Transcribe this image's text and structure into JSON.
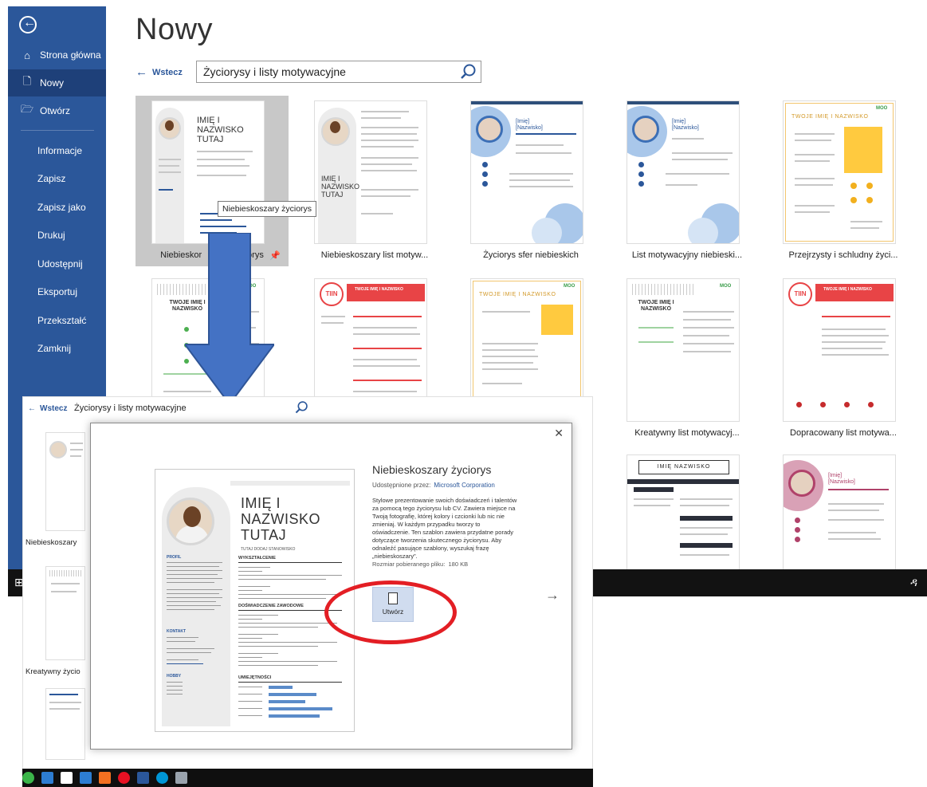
{
  "window": {
    "title": "Nowy",
    "sidebar": {
      "items": [
        {
          "label": "Strona główna",
          "icon": "home-icon"
        },
        {
          "label": "Nowy",
          "icon": "new-document-icon"
        },
        {
          "label": "Otwórz",
          "icon": "folder-open-icon"
        },
        {
          "label": "Informacje"
        },
        {
          "label": "Zapisz"
        },
        {
          "label": "Zapisz jako"
        },
        {
          "label": "Drukuj"
        },
        {
          "label": "Udostępnij"
        },
        {
          "label": "Eksportuj"
        },
        {
          "label": "Przekształć"
        },
        {
          "label": "Zamknij"
        }
      ]
    },
    "back_label": "Wstecz",
    "search_value": "Życiorysy i listy motywacyjne",
    "tooltip": "Niebieskoszary życiorys",
    "templates": [
      {
        "caption": "Niebieskoszary życiorys",
        "caption_partial_a": "Niebieskor",
        "caption_partial_b": "życiorys"
      },
      {
        "caption": "Niebieskoszary list motyw..."
      },
      {
        "caption": "Życiorys sfer niebieskich"
      },
      {
        "caption": "List motywacyjny niebieski..."
      },
      {
        "caption": "Przejrzysty i schludny życi..."
      },
      {
        "caption": ""
      },
      {
        "caption": ""
      },
      {
        "caption": ""
      },
      {
        "caption": "Kreatywny list motywacyj..."
      },
      {
        "caption": "Dopracowany list motywa..."
      }
    ]
  },
  "overlay": {
    "back_label": "Wstecz",
    "search_value": "Życiorysy i listy motywacyjne",
    "left_captions": [
      "Niebieskoszary",
      "Kreatywny życio"
    ]
  },
  "dialog": {
    "title": "Niebieskoszary życiorys",
    "provided_by_label": "Udostępnione przez:",
    "provider": "Microsoft Corporation",
    "description": "Stylowe prezentowanie swoich doświadczeń i talentów za pomocą tego życiorysu lub CV. Zawiera miejsce na Twoją fotografię, której kolory i czcionki lub nic nie zmieniaj. W każdym przypadku tworzy to oświadczenie. Ten szablon zawiera przydatne porady dotyczące tworzenia skutecznego życiorysu. Aby odnaleźć pasujące szablony, wyszukaj frazę „niebieskoszary”.",
    "size_label": "Rozmiar pobieranego pliku:",
    "size_value": "180 KB",
    "create_label": "Utwórz",
    "preview": {
      "name_line1": "IMIĘ I",
      "name_line2": "NAZWISKO",
      "name_line3": "TUTAJ",
      "subtitle": "TUTAJ DODAJ STANOWISKO",
      "side_profile": "PROFIL",
      "side_contact": "KONTAKT",
      "side_hobby": "HOBBY",
      "sec_education": "WYKSZTAŁCENIE",
      "sec_experience": "DOŚWIADCZENIE ZAWODOWE",
      "sec_skills": "UMIEJĘTNOŚCI"
    }
  },
  "thumb_text": {
    "t1_name": [
      "IMIĘ I",
      "NAZWISKO",
      "TUTAJ"
    ],
    "t2_name": [
      "IMIĘ I",
      "NAZWISKO",
      "TUTAJ"
    ],
    "t3_name": [
      "[Imię]",
      "[Nazwisko]"
    ],
    "t4_name": [
      "[Imię]",
      "[Nazwisko]"
    ],
    "t5_title": "TWOJE IMIĘ I NAZWISKO",
    "t6_title": [
      "TWOJE IMIĘ I",
      "NAZWISKO"
    ],
    "t7_title": "TWOJE IMIĘ I NAZWISKO",
    "t8_title": "TWOJE IMIĘ I NAZWISKO",
    "t9_title": [
      "TWOJE IMIĘ I",
      "NAZWISKO"
    ],
    "t10_title": "TWOJE IMIĘ I NAZWISKO",
    "t11_title": "IMIĘ NAZWISKO",
    "t12_name": [
      "[Imię]",
      "[Nazwisko]"
    ],
    "moo": "MOO",
    "tiin": "TIIN"
  },
  "colors": {
    "word_blue": "#2b579a",
    "accent_red": "#e31e24",
    "arrow_blue": "#4472c4"
  }
}
